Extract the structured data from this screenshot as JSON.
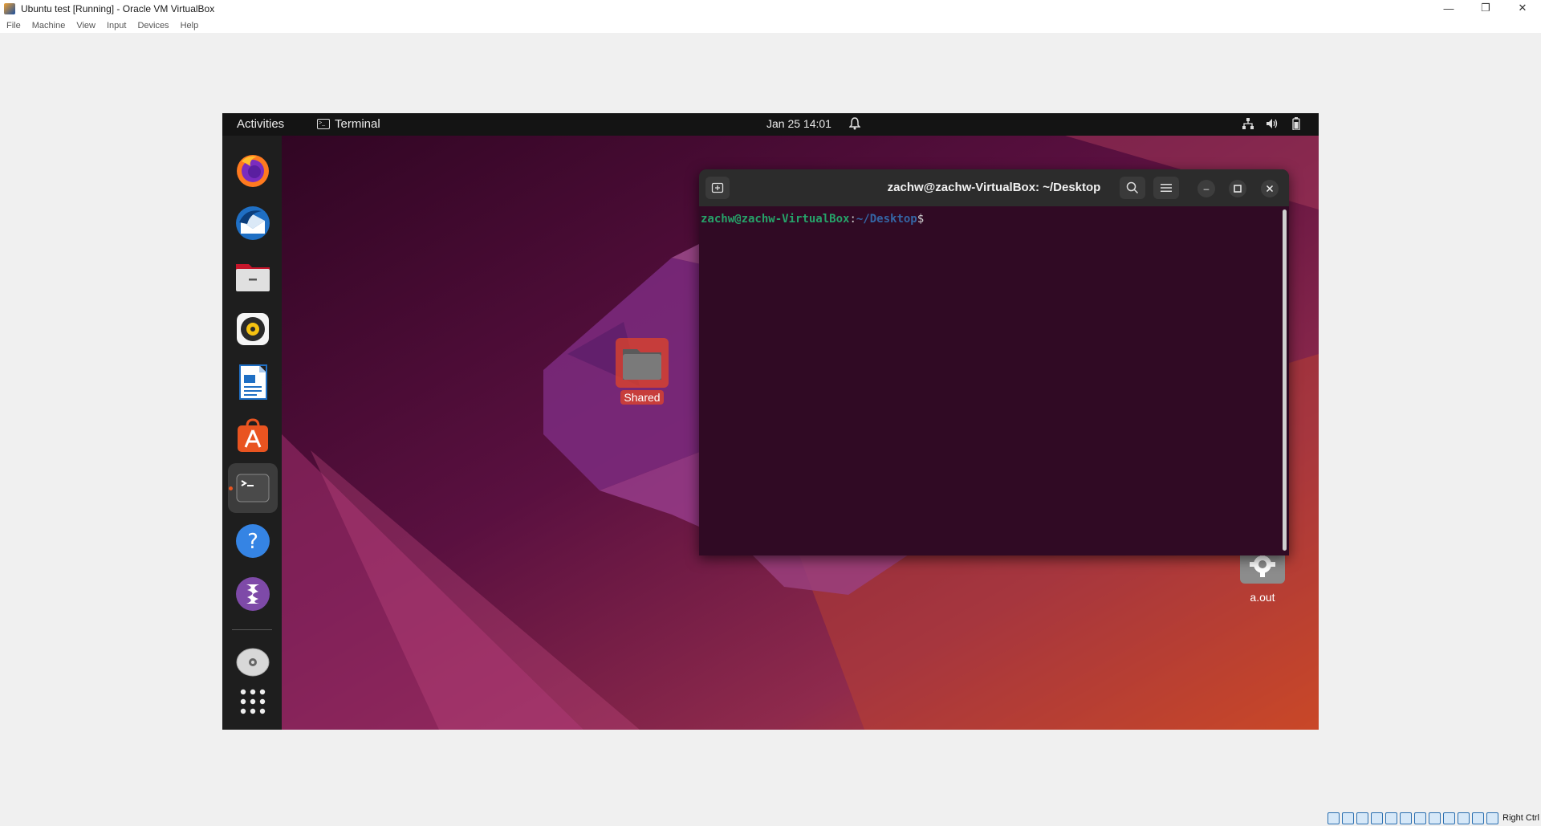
{
  "host": {
    "title": "Ubuntu test [Running] - Oracle VM VirtualBox",
    "controls": [
      "minimize",
      "restore",
      "close"
    ],
    "menu": [
      "File",
      "Machine",
      "View",
      "Input",
      "Devices",
      "Help"
    ],
    "status_text": "Right Ctrl"
  },
  "topbar": {
    "activities": "Activities",
    "app_name": "Terminal",
    "clock": "Jan 25  14:01"
  },
  "dock": {
    "items": [
      "firefox-icon",
      "thunderbird-icon",
      "files-icon",
      "rhythmbox-icon",
      "libreoffice-writer-icon",
      "app-center-icon",
      "terminal-icon",
      "help-icon",
      "emacs-icon",
      "dvd-icon",
      "show-apps-icon"
    ],
    "active": "terminal-icon"
  },
  "desktop": {
    "shared_label": "Shared",
    "aout_label": "a.out"
  },
  "terminal": {
    "title": "zachw@zachw-VirtualBox: ~/Desktop",
    "prompt_user": "zachw@zachw-VirtualBox",
    "prompt_colon": ":",
    "prompt_path": "~/Desktop",
    "prompt_dollar": "$"
  },
  "colors": {
    "accent": "#e95420",
    "terminal_bg": "#300a24",
    "prompt_green": "#26a269",
    "prompt_blue": "#3465a4"
  }
}
